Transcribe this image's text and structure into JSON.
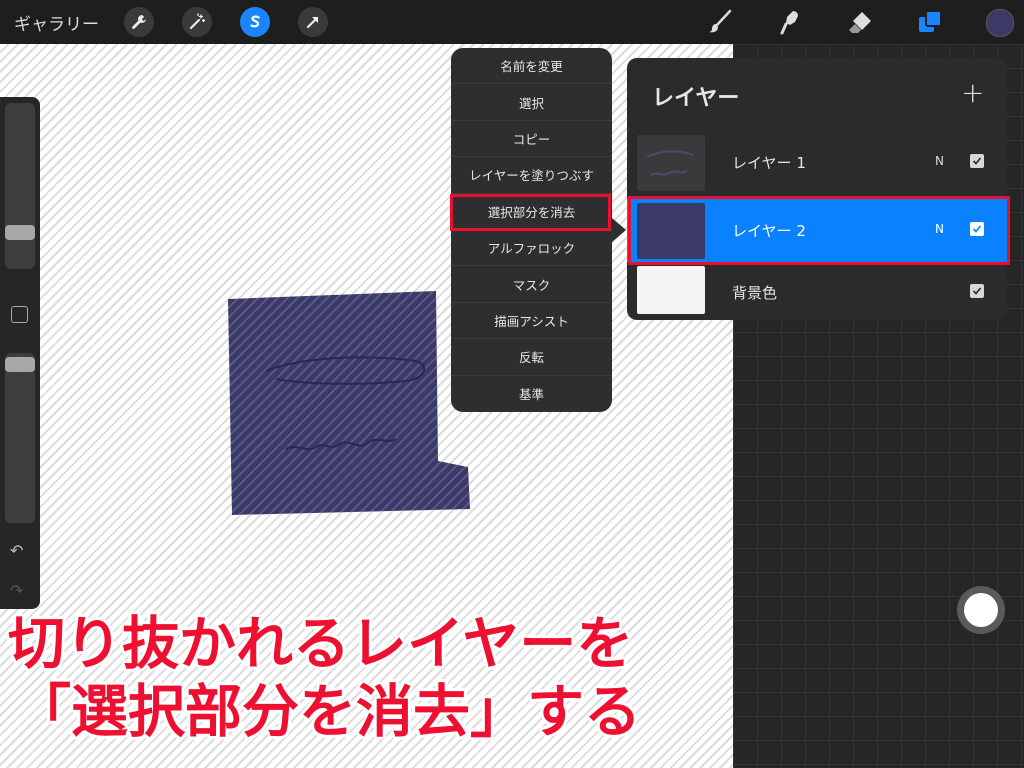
{
  "toolbar": {
    "gallery_label": "ギャラリー",
    "left_tools": [
      "wrench-icon",
      "magic-wand-icon",
      "selection-icon",
      "arrow-icon"
    ],
    "active_tool": "selection-icon",
    "right_tools": [
      "brush-icon",
      "smudge-icon",
      "eraser-icon",
      "layers-icon"
    ],
    "current_color": "#3b3966"
  },
  "context_menu": {
    "items": [
      "名前を変更",
      "選択",
      "コピー",
      "レイヤーを塗りつぶす",
      "選択部分を消去",
      "アルファロック",
      "マスク",
      "描画アシスト",
      "反転",
      "基準"
    ],
    "highlighted": "選択部分を消去"
  },
  "layers_panel": {
    "title": "レイヤー",
    "add_symbol": "+",
    "layers": [
      {
        "name": "レイヤー 1",
        "mode": "N",
        "visible": true,
        "selected": false
      },
      {
        "name": "レイヤー 2",
        "mode": "N",
        "visible": true,
        "selected": true
      },
      {
        "name": "背景色",
        "mode": "",
        "visible": true,
        "selected": false
      }
    ]
  },
  "caption": {
    "line1": "切り抜かれるレイヤーを",
    "line2": "「選択部分を消去」する"
  },
  "colors": {
    "accent": "#0a82ff",
    "highlight_border": "#e8102e",
    "caption_text": "#ee1030",
    "artwork_fill": "#3b3966"
  }
}
